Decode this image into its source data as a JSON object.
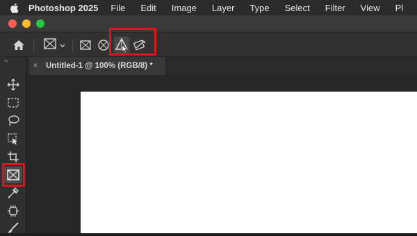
{
  "menubar": {
    "apple_icon": "apple-logo-icon",
    "app_name": "Photoshop 2025",
    "items": [
      "File",
      "Edit",
      "Image",
      "Layer",
      "Type",
      "Select",
      "Filter",
      "View",
      "Pl"
    ]
  },
  "window": {
    "traffic_lights": {
      "close": "#ff5f57",
      "minimize": "#febc2e",
      "zoom": "#28c840"
    }
  },
  "options_bar": {
    "home_icon": "home-icon",
    "tool_preset_icon": "frame-tool-icon",
    "preset_dropdown_icon": "chevron-down-icon",
    "buttons": [
      "rectangle-frame-icon",
      "ellipse-frame-icon",
      "dodge-triangle-icon",
      "pen-frame-icon"
    ],
    "highlighted_button_color": "#e0121b"
  },
  "tabs": [
    {
      "label": "Untitled-1 @ 100% (RGB/8) *",
      "close_glyph": "×"
    }
  ],
  "toolbar": {
    "collapse_glyph": "››",
    "tools": [
      "move-tool-icon",
      "rectangular-marquee-icon",
      "lasso-icon",
      "object-selection-icon",
      "crop-icon",
      "frame-tool-icon",
      "eyedropper-icon",
      "healing-brush-icon",
      "brush-icon"
    ],
    "active_tool": "frame-tool-icon"
  }
}
